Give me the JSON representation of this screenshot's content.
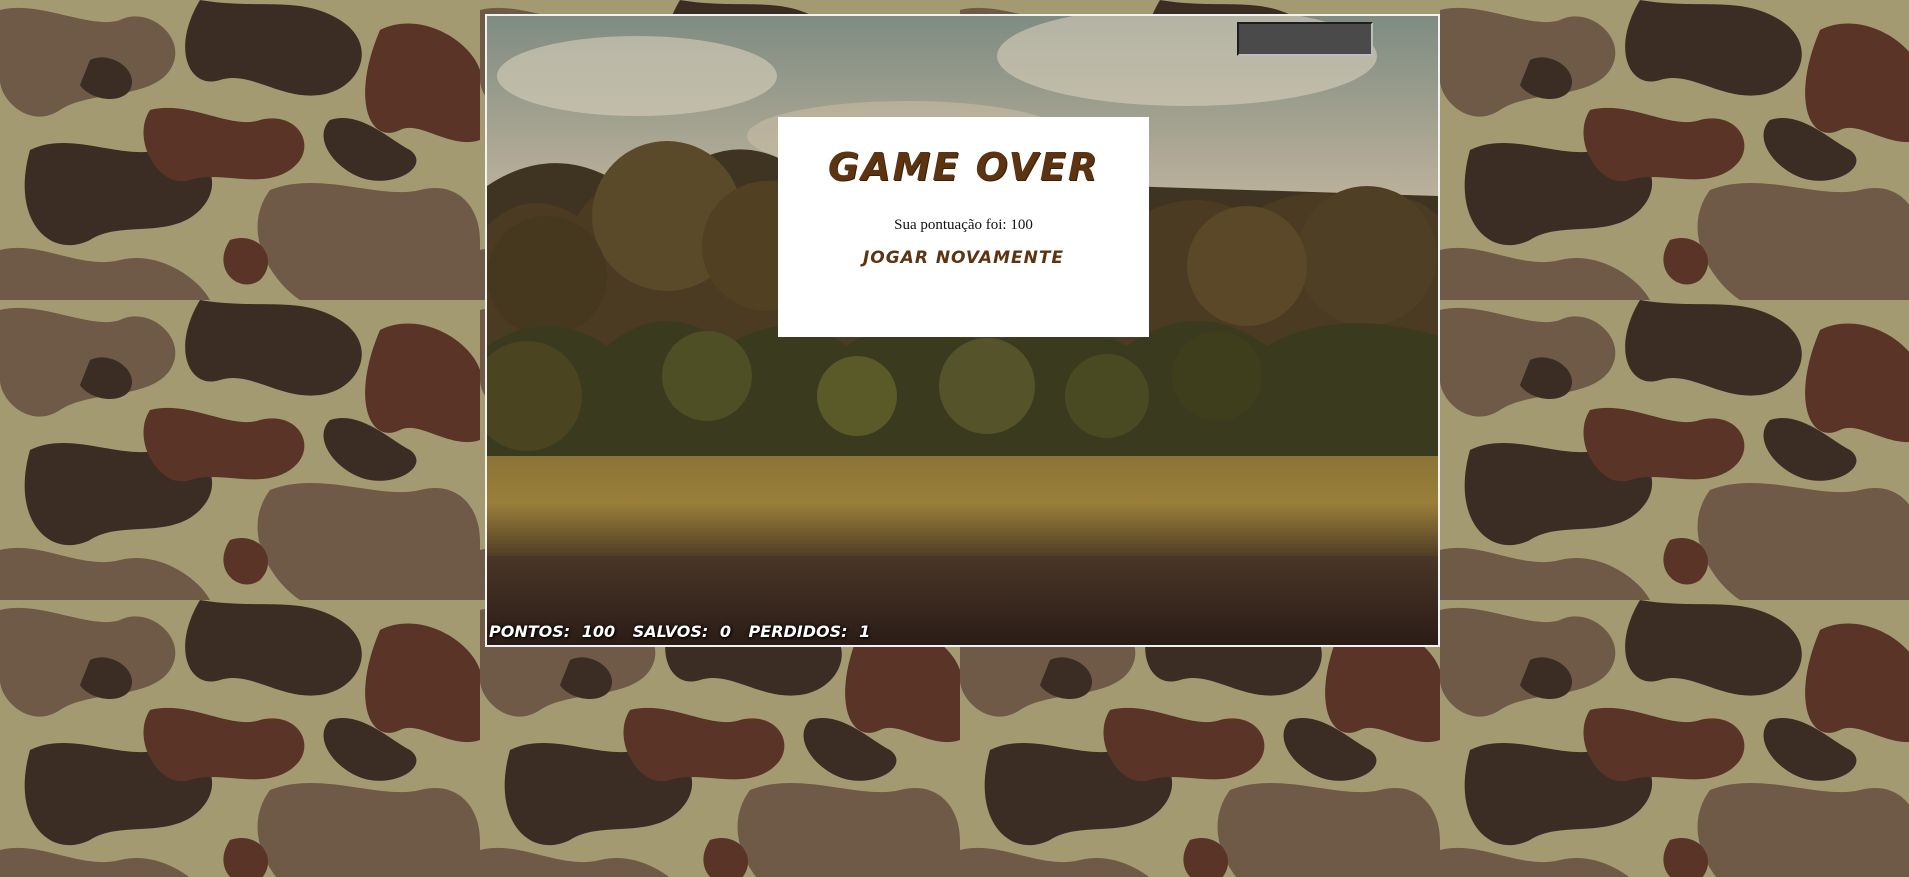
{
  "gameover": {
    "title": "GAME OVER",
    "score_text": "Sua pontuação foi: 100",
    "play_again_label": "JOGAR NOVAMENTE"
  },
  "hud": {
    "pontos_label": "PONTOS:",
    "pontos_value": "100",
    "salvos_label": "SALVOS:",
    "salvos_value": "0",
    "perdidos_label": "PERDIDOS:",
    "perdidos_value": "1"
  },
  "colors": {
    "panel_text": "#5c3411",
    "camo": [
      "#a39a72",
      "#6e5a46",
      "#3b2d24",
      "#5a3426"
    ]
  }
}
